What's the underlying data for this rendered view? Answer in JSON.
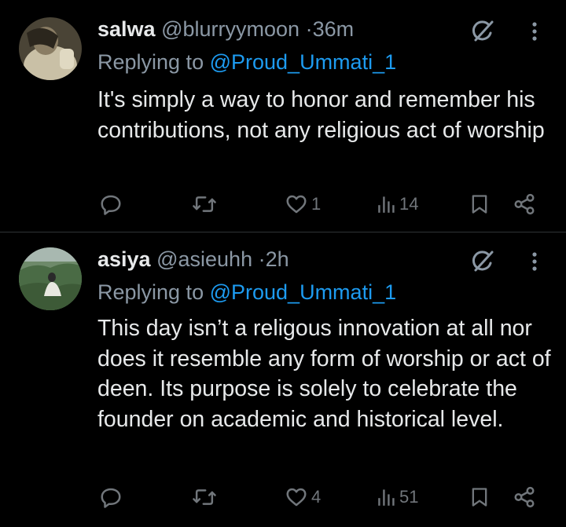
{
  "tweets": [
    {
      "name": "salwa",
      "handle": "@blurryymoon",
      "separator": "·",
      "time": "36m",
      "replying_prefix": "Replying to ",
      "replying_to": "@Proud_Ummati_1",
      "text": "It's simply a way to honor and remember his contributions, not any religious act of worship",
      "likes": "1",
      "views": "14"
    },
    {
      "name": "asiya",
      "handle": "@asieuhh",
      "separator": "·",
      "time": "2h",
      "replying_prefix": "Replying to ",
      "replying_to": "@Proud_Ummati_1",
      "text": "This day isn’t a religous innovation at all nor does it resemble any form of worship or act of deen. Its purpose is solely to celebrate the founder on academic and historical level.",
      "likes": "4",
      "views": "51"
    }
  ],
  "icons": {
    "reply": "reply-bubble-icon",
    "retweet": "retweet-icon",
    "like": "heart-icon",
    "views": "views-bar-icon",
    "bookmark": "bookmark-icon",
    "share": "share-icon",
    "grok": "grok-icon",
    "more": "more-vertical-icon"
  },
  "colors": {
    "background": "#000000",
    "text": "#e7e9ea",
    "secondary": "#8b98a5",
    "mention": "#1d9bf0",
    "divider": "#2f3336"
  }
}
